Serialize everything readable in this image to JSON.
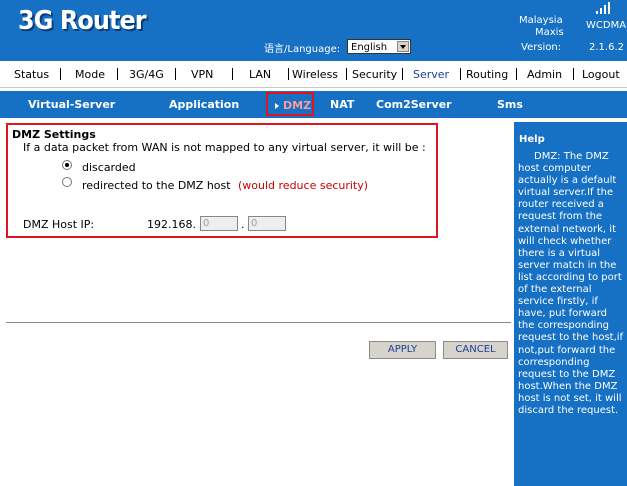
{
  "header": {
    "logo": "3G Router",
    "language_label": "语言/Language:",
    "language_value": "English",
    "country": "Malaysia",
    "operator": "Maxis",
    "network": "WCDMA",
    "version_label": "Version:",
    "version_value": "2.1.6.2"
  },
  "mainnav": {
    "items": [
      "Status",
      "Mode",
      "3G/4G",
      "VPN",
      "LAN",
      "Wireless",
      "Security",
      "Server",
      "Routing",
      "Admin",
      "Logout"
    ],
    "active": "Server"
  },
  "subnav": {
    "items": [
      "Virtual-Server",
      "Application",
      "DMZ",
      "NAT",
      "Com2Server",
      "Sms"
    ],
    "active": "DMZ"
  },
  "dmz": {
    "title": "DMZ Settings",
    "description": "If a data packet from WAN is not mapped to any virtual server, it will be :",
    "option_discarded": "discarded",
    "option_redirect": "redirected to the DMZ host",
    "redirect_warning": "(would reduce security)",
    "selected": "discarded",
    "host_ip_label": "DMZ Host IP:",
    "ip_prefix": "192.168.",
    "ip_octet3": "0",
    "ip_dot": ".",
    "ip_octet4": "0"
  },
  "buttons": {
    "apply": "APPLY",
    "cancel": "CANCEL"
  },
  "help": {
    "title": "Help",
    "body": "DMZ: The DMZ host computer actually is a default virtual server.If the router received a request from the external network, it will check whether there is a virtual server match in the list according to port of the external service firstly, if have, put forward the corresponding request to the host,if not,put forward the corresponding request to the DMZ host.When the DMZ host is not set, it will discard the request."
  },
  "colors": {
    "brand_blue": "#1670c4",
    "highlight_red": "#e0141e",
    "warning_text": "#cc0000"
  }
}
